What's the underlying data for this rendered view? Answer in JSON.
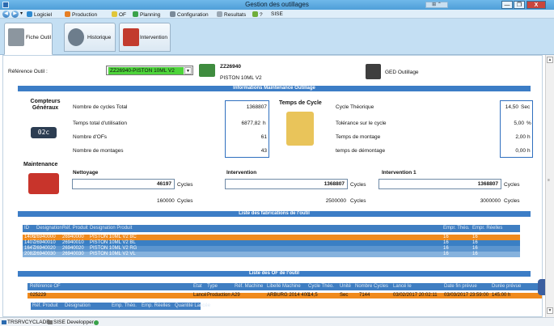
{
  "window": {
    "title": "Gestion des outillages",
    "grid_text": "⊞ ⌃",
    "min": "—",
    "max": "❐",
    "close": "X"
  },
  "menu": {
    "back": "◀",
    "forward": "▶",
    "dropdown": "▾",
    "items": [
      {
        "label": "Logiciel",
        "color": "#2e8ad0"
      },
      {
        "label": "Production",
        "color": "#e67f24"
      },
      {
        "label": "OF",
        "color": "#e0c63a"
      },
      {
        "label": "Planning",
        "color": "#3aa24a"
      },
      {
        "label": "Configuration",
        "color": "#7a8a99"
      },
      {
        "label": "Resultats",
        "color": "#9aa7b3"
      },
      {
        "label": "?",
        "color": "#6fae3a"
      },
      {
        "label": "SISE",
        "color": ""
      }
    ]
  },
  "tabs": [
    {
      "label": "Fiche Outil",
      "icon": "tool-sheet-icon"
    },
    {
      "label": "Historique",
      "icon": "history-icon"
    },
    {
      "label": "Intervention",
      "icon": "intervention-icon"
    }
  ],
  "header": {
    "ref_label": "Référence Outil :",
    "ref_value": "ZZ26940-PISTON 10ML V2",
    "code": "ZZ26940",
    "name": "PISTON 10ML V2",
    "ged_label": "GED Outillage"
  },
  "maintenance_info": {
    "title": "Informations Maintenance Outillage",
    "counters_title": "Compteurs Généraux",
    "counter_display": "02c",
    "counters": [
      {
        "label": "Nombre de cycles Total",
        "value": "1368807"
      },
      {
        "label": "Temps total d'utilisation",
        "value": "6877,82",
        "unit": "h"
      },
      {
        "label": "Nombre d'OFs",
        "value": "61"
      },
      {
        "label": "Nombre de montages",
        "value": "43"
      }
    ],
    "cycle_title": "Temps de Cycle",
    "cycle": [
      {
        "label": "Cycle Théorique",
        "value": "14,50",
        "unit": "Sec"
      },
      {
        "label": "Tolérance sur le cycle",
        "value": "5,00",
        "unit": "%"
      },
      {
        "label": "Temps de montage",
        "value": "2,00",
        "unit": "h"
      },
      {
        "label": "temps de démontage",
        "value": "0,00",
        "unit": "h"
      }
    ],
    "maintenance_title": "Maintenance",
    "nettoyage": {
      "label": "Nettoyage",
      "value": "46197",
      "unit": "Cycles",
      "threshold": "160000",
      "threshold_unit": "Cycles"
    },
    "intervention": {
      "label": "Intervention",
      "value": "1368807",
      "unit": "Cycles",
      "threshold": "2500000",
      "threshold_unit": "Cycles"
    },
    "intervention1": {
      "label": "Intervention 1",
      "value": "1368807",
      "unit": "Cycles",
      "threshold": "3000000",
      "threshold_unit": "Cycles"
    }
  },
  "fabrications": {
    "title": "Liste des fabrications de l'outil",
    "columns": [
      "ID",
      "Designation",
      "Réf. Produit",
      "Designation Produit",
      "Empr. Théo.",
      "Empr. Réelles"
    ],
    "rows": [
      {
        "id": "1406",
        "designation": "26940000",
        "ref": "26940000",
        "produit": "PISTON 10ML V2 BC",
        "theo": "16",
        "reel": "16",
        "bg": "#f08a1c"
      },
      {
        "id": "1407",
        "designation": "26940010",
        "ref": "26940010",
        "produit": "PISTON 10ML V2 BL",
        "theo": "16",
        "reel": "16",
        "bg": "#3a7fc4"
      },
      {
        "id": "1647",
        "designation": "26940020",
        "ref": "26940020",
        "produit": "PISTON 10ML V2 RG",
        "theo": "16",
        "reel": "16",
        "bg": "#5b95cf"
      },
      {
        "id": "2082",
        "designation": "26940030",
        "ref": "26940030",
        "produit": "PISTON 10ML V2 VL",
        "theo": "16",
        "reel": "16",
        "bg": "#86b2dd"
      }
    ]
  },
  "of_list": {
    "title": "Liste des OF de l'outil",
    "columns": [
      "Référence OF",
      "Etat",
      "Type",
      "Réf. Machine",
      "Libellé Machine",
      "Cycle Théo.",
      "Unité",
      "Nombre Cycles",
      "Lancé le",
      "Date fin prévue",
      "Durée prévue"
    ],
    "row": {
      "ref": "025229",
      "etat": "Lancé",
      "type": "Production A29",
      "ref_machine": "",
      "libelle": "ARBURG 2014 400",
      "cycle": "14,5",
      "unite": "Sec",
      "nb": "7144",
      "lance": "03/02/2017 20:02:11",
      "fin": "03/03/2017 23:59:00",
      "duree": "145.00 h"
    },
    "sub_columns": [
      "Réf. Produit",
      "Désignation",
      "Emp. Théo.",
      "Emp. Réelles",
      "Quantité Lancée"
    ]
  },
  "statusbar": {
    "server": "TRSRVCYCLADE",
    "user": "SISE Developper"
  }
}
